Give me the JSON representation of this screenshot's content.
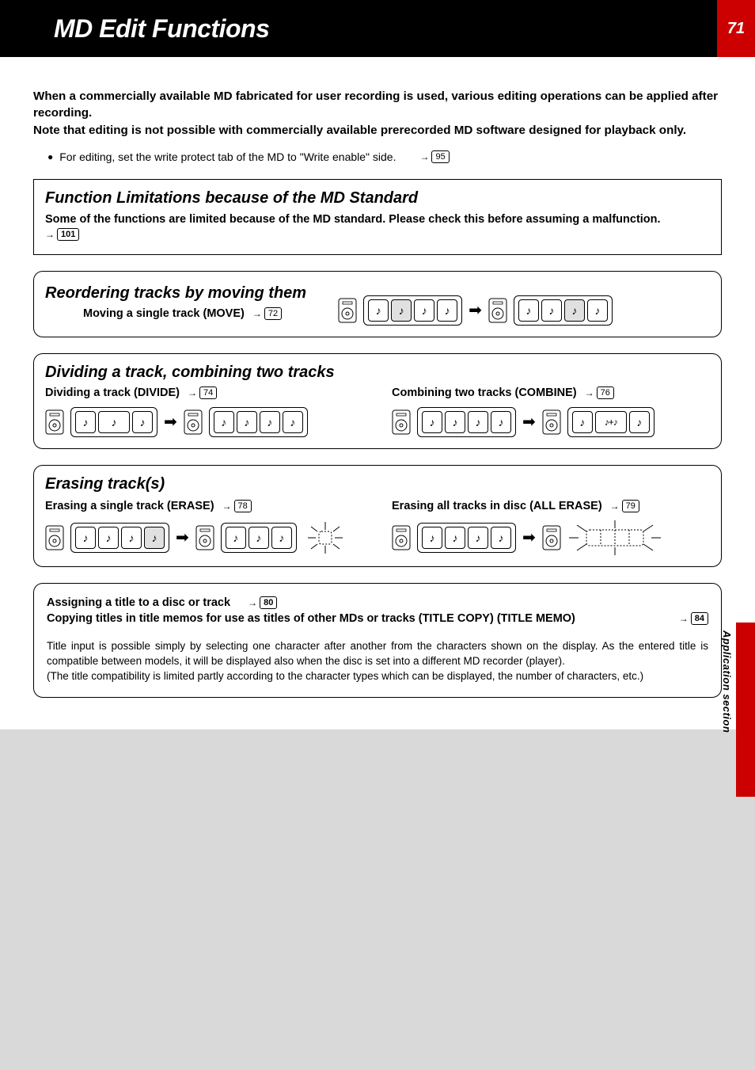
{
  "page_number": "71",
  "header_title": "MD Edit Functions",
  "intro": {
    "p1": "When a commercially available MD fabricated for user recording is used, various editing operations can be applied after recording.",
    "p2": "Note that editing is not possible with commercially available prerecorded MD software designed for playback only.",
    "bullet": "For editing, set the write protect tab of the MD to \"Write enable\" side.",
    "bullet_ref": "95"
  },
  "limitations": {
    "heading": "Function Limitations because of the MD Standard",
    "body": "Some of the functions are limited because of the MD standard. Please check this before assuming a malfunction.",
    "ref": "101"
  },
  "reorder": {
    "heading": "Reordering tracks by moving them",
    "sub": "Moving a single track (MOVE)",
    "ref": "72"
  },
  "divide": {
    "heading": "Dividing a track, combining two tracks",
    "sub1": "Dividing a track (DIVIDE)",
    "ref1": "74",
    "sub2": "Combining two tracks (COMBINE)",
    "ref2": "76"
  },
  "erase": {
    "heading": "Erasing track(s)",
    "sub1": "Erasing a single track (ERASE)",
    "ref1": "78",
    "sub2": "Erasing all tracks in disc (ALL ERASE)",
    "ref2": "79"
  },
  "title_block": {
    "line1": "Assigning a title to a disc or track",
    "ref1": "80",
    "line2": "Copying titles in title memos for use as titles of other MDs or tracks (TITLE COPY) (TITLE MEMO)",
    "ref2": "84",
    "body": "Title input is possible simply by selecting one character after another from the characters shown on the display. As the entered title is compatible between models, it will be displayed also when the disc is set into a different MD recorder (player).\n(The title compatibility is limited partly according to the character types which can be displayed, the number of characters, etc.)"
  },
  "side_label": "Application section",
  "glyphs": {
    "note": "♪",
    "arrow": "➡",
    "combine": "♪+♪"
  }
}
